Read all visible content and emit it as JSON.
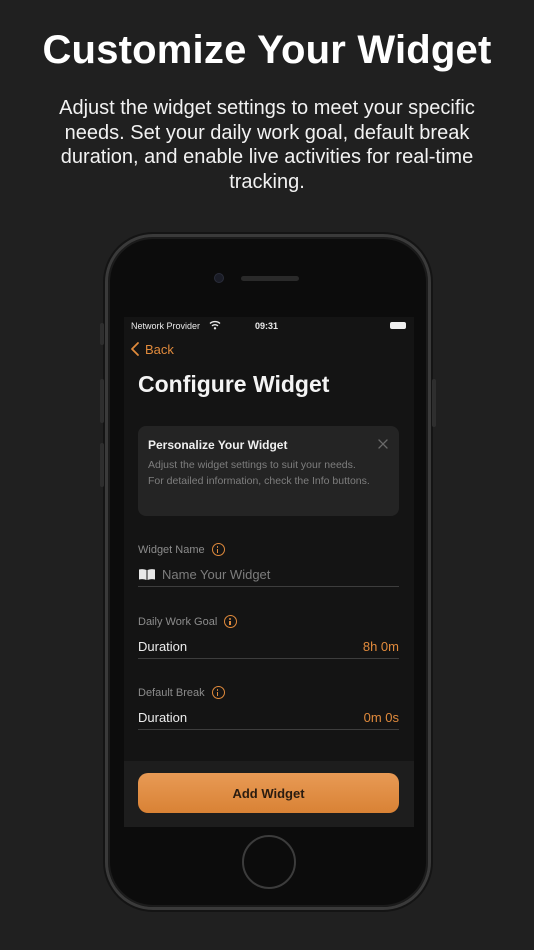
{
  "promo": {
    "headline": "Customize Your Widget",
    "subtitle": "Adjust the widget settings to meet your specific needs. Set your daily work goal, default break duration, and enable live activities for real-time tracking."
  },
  "status_bar": {
    "carrier": "Network Provider",
    "time": "09:31"
  },
  "nav": {
    "back_label": "Back"
  },
  "page": {
    "title": "Configure Widget"
  },
  "info_card": {
    "title": "Personalize Your Widget",
    "text": "Adjust the widget settings to suit your needs. For detailed information, check the Info buttons."
  },
  "fields": {
    "widget_name": {
      "label": "Widget Name",
      "placeholder": "Name Your Widget"
    },
    "daily_work_goal": {
      "label": "Daily Work Goal",
      "row_label": "Duration",
      "value": "8h 0m"
    },
    "default_break": {
      "label": "Default Break",
      "row_label": "Duration",
      "value": "0m 0s"
    }
  },
  "actions": {
    "add_widget_label": "Add Widget"
  },
  "colors": {
    "accent": "#e08a3c",
    "background": "#202020",
    "screen": "#141414"
  },
  "icons": [
    "wifi-icon",
    "battery-icon",
    "chevron-left-icon",
    "close-icon",
    "info-icon",
    "book-icon"
  ]
}
